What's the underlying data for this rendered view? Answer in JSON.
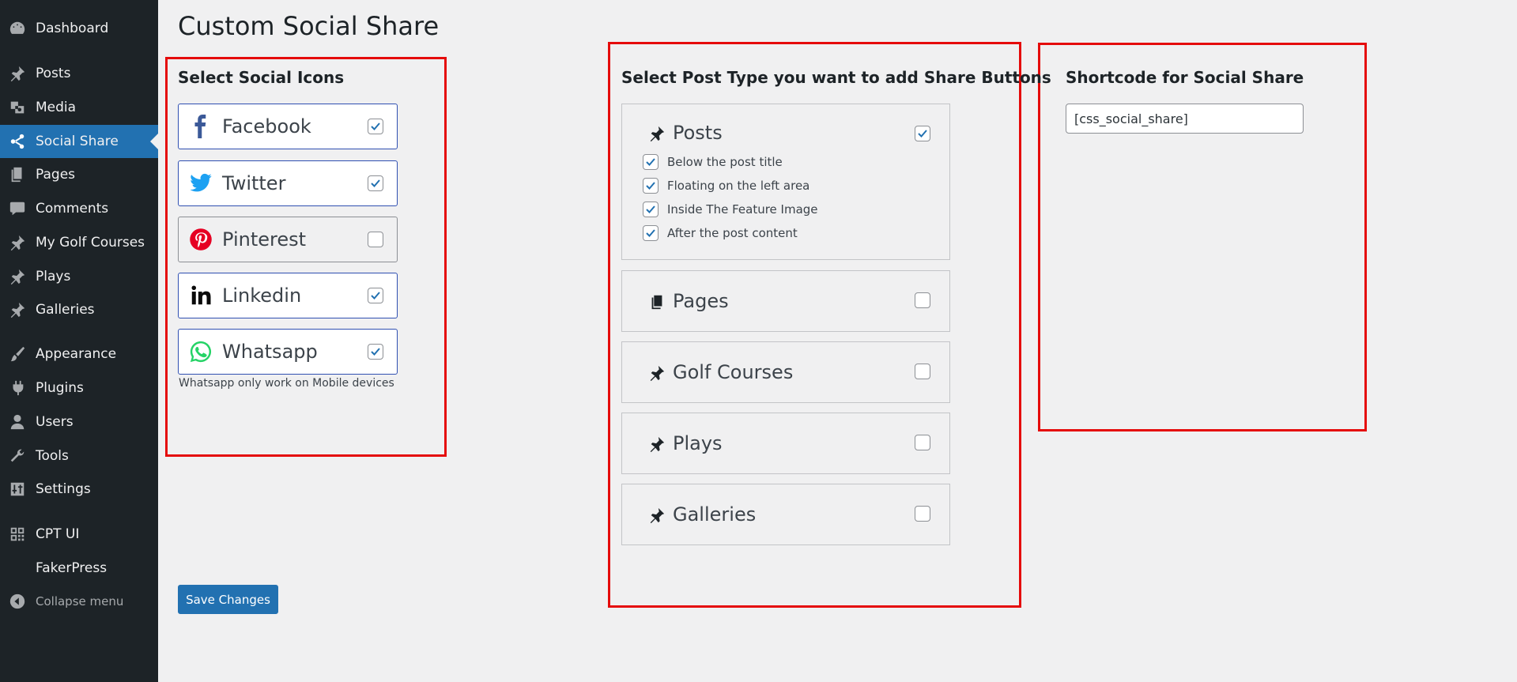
{
  "sidebar": {
    "items": [
      {
        "label": "Dashboard",
        "icon": "dashboard-icon"
      },
      {
        "label": "Posts",
        "icon": "pin-icon"
      },
      {
        "label": "Media",
        "icon": "media-icon"
      },
      {
        "label": "Social Share",
        "icon": "share-icon",
        "active": true
      },
      {
        "label": "Pages",
        "icon": "pages-icon"
      },
      {
        "label": "Comments",
        "icon": "comments-icon"
      },
      {
        "label": "My Golf Courses",
        "icon": "pin-icon"
      },
      {
        "label": "Plays",
        "icon": "pin-icon"
      },
      {
        "label": "Galleries",
        "icon": "pin-icon"
      },
      {
        "label": "Appearance",
        "icon": "brush-icon"
      },
      {
        "label": "Plugins",
        "icon": "plugin-icon"
      },
      {
        "label": "Users",
        "icon": "user-icon"
      },
      {
        "label": "Tools",
        "icon": "wrench-icon"
      },
      {
        "label": "Settings",
        "icon": "settings-icon"
      },
      {
        "label": "CPT UI",
        "icon": "cpt-icon"
      },
      {
        "label": "FakerPress",
        "icon": ""
      },
      {
        "label": "Collapse menu",
        "icon": "collapse-icon"
      }
    ]
  },
  "page": {
    "title": "Custom Social Share"
  },
  "social_icons": {
    "heading": "Select Social Icons",
    "items": [
      {
        "label": "Facebook",
        "icon": "facebook-icon",
        "checked": true
      },
      {
        "label": "Twitter",
        "icon": "twitter-icon",
        "checked": true
      },
      {
        "label": "Pinterest",
        "icon": "pinterest-icon",
        "checked": false
      },
      {
        "label": "Linkedin",
        "icon": "linkedin-icon",
        "checked": true
      },
      {
        "label": "Whatsapp",
        "icon": "whatsapp-icon",
        "checked": true
      }
    ],
    "note": "Whatsapp only work on Mobile devices"
  },
  "post_types": {
    "heading": "Select Post Type you want to add Share Buttons",
    "items": [
      {
        "label": "Posts",
        "icon": "pin-icon",
        "checked": true,
        "options": [
          {
            "label": "Below the post title",
            "checked": true
          },
          {
            "label": "Floating on the left area",
            "checked": true
          },
          {
            "label": "Inside The Feature Image",
            "checked": true
          },
          {
            "label": "After the post content",
            "checked": true
          }
        ]
      },
      {
        "label": "Pages",
        "icon": "pages-icon",
        "checked": false
      },
      {
        "label": "Golf Courses",
        "icon": "pin-icon",
        "checked": false
      },
      {
        "label": "Plays",
        "icon": "pin-icon",
        "checked": false
      },
      {
        "label": "Galleries",
        "icon": "pin-icon",
        "checked": false
      }
    ]
  },
  "shortcode": {
    "heading": "Shortcode for Social Share",
    "value": "[css_social_share]"
  },
  "actions": {
    "save_label": "Save Changes"
  },
  "colors": {
    "sidebar_bg": "#1d2327",
    "accent": "#2271b1",
    "highlight_box": "#e50b0b",
    "facebook": "#3b5998",
    "twitter": "#1da1f2",
    "pinterest": "#e60023",
    "linkedin": "#0a0a0a",
    "whatsapp": "#25d366"
  }
}
